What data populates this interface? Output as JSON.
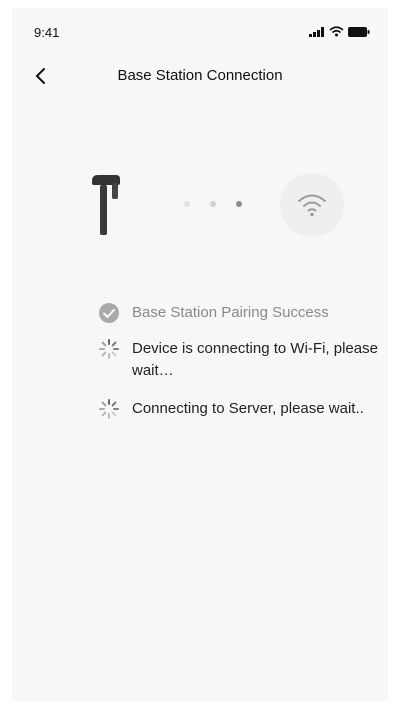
{
  "status_bar": {
    "time": "9:41",
    "icons": [
      "signal-icon",
      "wifi-icon",
      "battery-icon"
    ]
  },
  "nav": {
    "title": "Base Station Connection",
    "back_icon": "chevron-left-icon"
  },
  "illustration": {
    "station_icon": "base-station-icon",
    "dots": 3,
    "wifi_icon": "wifi-icon"
  },
  "steps": [
    {
      "text": "Base Station Pairing Success",
      "state": "success",
      "icon": "check-circle-icon"
    },
    {
      "text": "Device is connecting to Wi-Fi, please wait…",
      "state": "loading",
      "icon": "spinner-icon"
    },
    {
      "text": "Connecting to Server, please wait..",
      "state": "loading",
      "icon": "spinner-icon"
    }
  ],
  "colors": {
    "background": "#f7f7f7",
    "text": "#111111",
    "muted_text": "#8a8a8a",
    "success": "#a9a9a9",
    "spinner": "#666666"
  }
}
